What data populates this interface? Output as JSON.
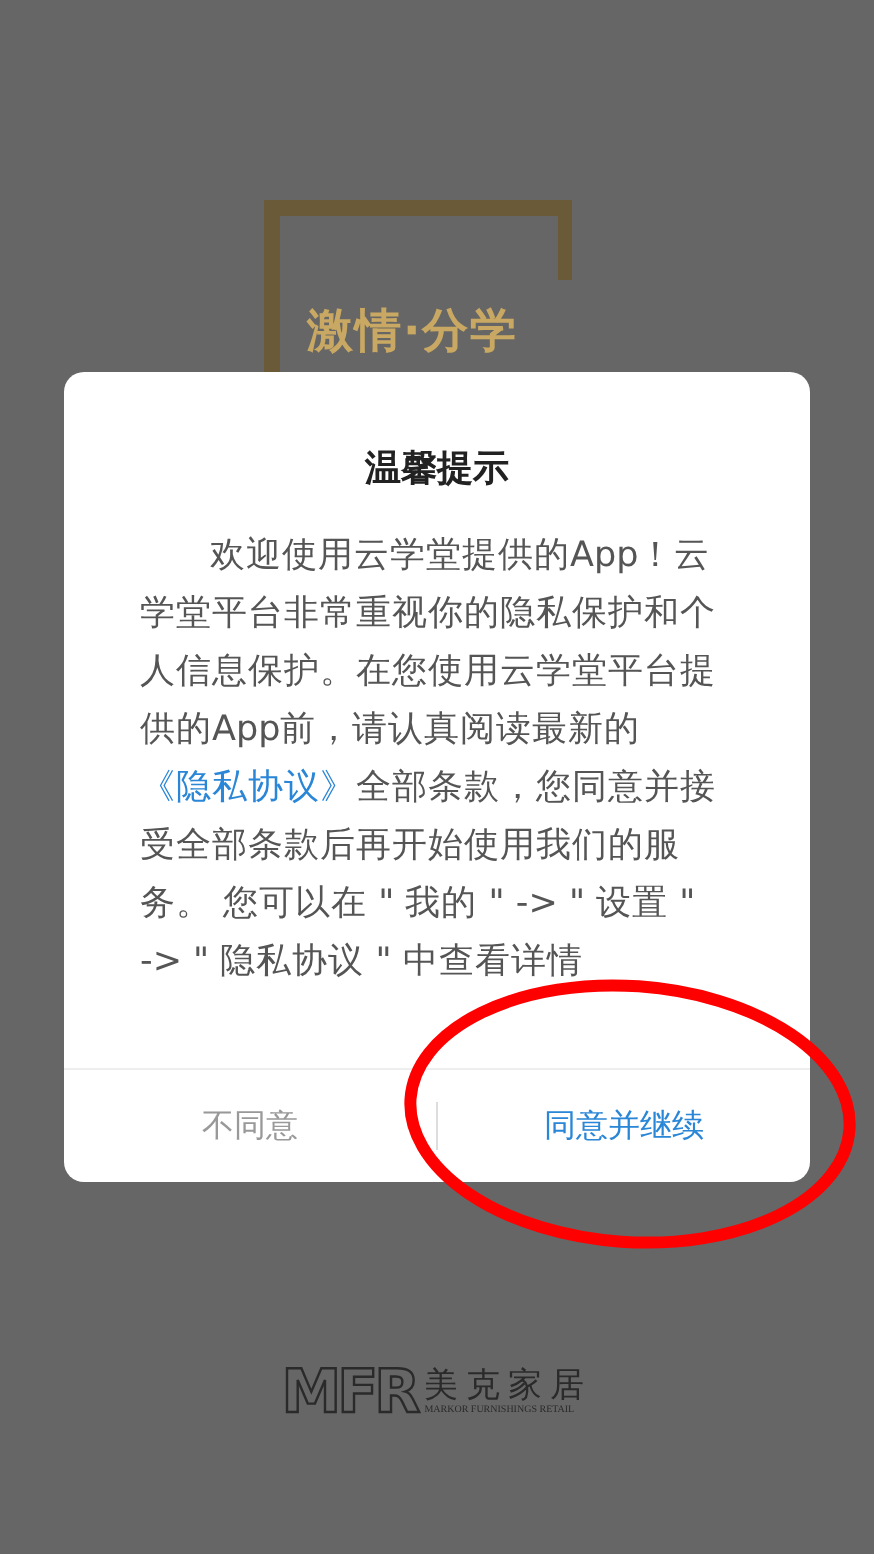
{
  "splash": {
    "slogan": "激情·分学",
    "logo": {
      "mark": "MFR",
      "name": "美克家居",
      "tagline": "MARKOR FURNISHINGS RETAIL"
    }
  },
  "dialog": {
    "title": "温馨提示",
    "message": {
      "before": "欢迎使用云学堂提供的App！云学堂平台非常重视你的隐私保护和个人信息保护。在您使用云学堂平台提供的App前，请认真阅读最新的",
      "link": "《隐私协议》",
      "after": "全部条款，您同意并接受全部条款后再开始使用我们的服务。 您可以在 \" 我的 \" -> \" 设置 \" -> \" 隐私协议 \" 中查看详情"
    },
    "buttons": [
      {
        "label": "不同意",
        "kind": "secondary"
      },
      {
        "label": "同意并继续",
        "kind": "primary"
      }
    ]
  },
  "annotation": {
    "kind": "ellipse"
  }
}
